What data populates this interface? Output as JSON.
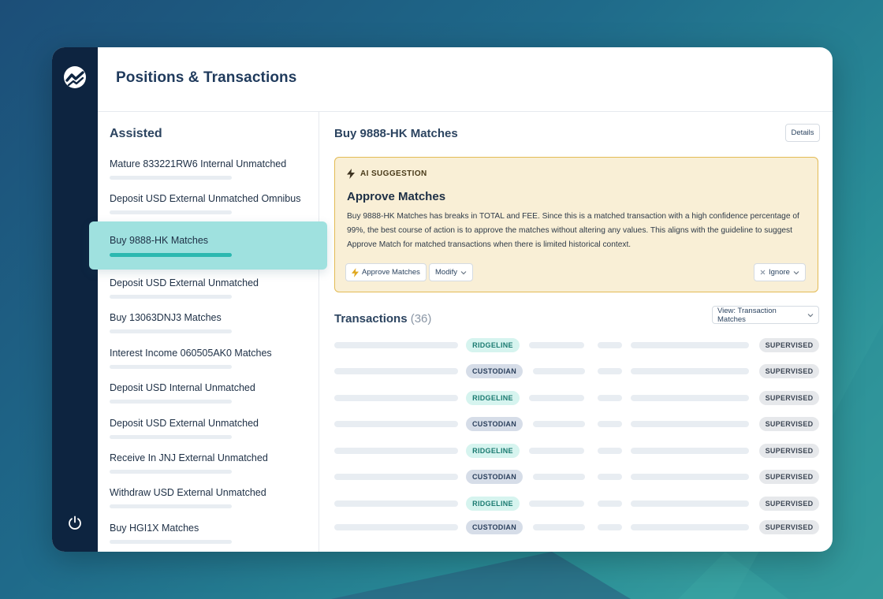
{
  "app": {
    "page_title": "Positions & Transactions"
  },
  "sidebar": {
    "title": "Assisted",
    "items": [
      {
        "label": "Mature 833221RW6 Internal Unmatched"
      },
      {
        "label": "Deposit USD External Unmatched Omnibus"
      },
      {
        "label": "Buy 9888-HK Matches",
        "active": true
      },
      {
        "label": "Deposit USD External Unmatched"
      },
      {
        "label": "Buy 13063DNJ3 Matches"
      },
      {
        "label": "Interest Income 060505AK0 Matches"
      },
      {
        "label": "Deposit USD Internal Unmatched"
      },
      {
        "label": "Deposit USD External Unmatched"
      },
      {
        "label": "Receive In JNJ External Unmatched"
      },
      {
        "label": "Withdraw USD External Unmatched"
      },
      {
        "label": "Buy HGI1X Matches"
      }
    ]
  },
  "main": {
    "title": "Buy 9888-HK Matches",
    "details_label": "Details",
    "ai": {
      "tag": "AI SUGGESTION",
      "heading": "Approve Matches",
      "body": "Buy 9888-HK Matches has breaks in TOTAL and FEE. Since this is a matched transaction with a high confidence percentage of 99%, the best course of action is to approve the matches without altering any values. This aligns with the guideline to suggest Approve Match for matched transactions when there is limited historical context.",
      "approve_label": "Approve Matches",
      "modify_label": "Modify",
      "ignore_label": "Ignore"
    },
    "transactions": {
      "title": "Transactions",
      "count": "(36)",
      "view_label": "View: Transaction Matches",
      "rows": [
        {
          "source": "RIDGELINE",
          "status": "SUPERVISED"
        },
        {
          "source": "CUSTODIAN",
          "status": "SUPERVISED"
        },
        {
          "source": "RIDGELINE",
          "status": "SUPERVISED"
        },
        {
          "source": "CUSTODIAN",
          "status": "SUPERVISED"
        },
        {
          "source": "RIDGELINE",
          "status": "SUPERVISED"
        },
        {
          "source": "CUSTODIAN",
          "status": "SUPERVISED"
        },
        {
          "source": "RIDGELINE",
          "status": "SUPERVISED"
        },
        {
          "source": "CUSTODIAN",
          "status": "SUPERVISED"
        }
      ]
    }
  },
  "icons": {
    "rail_logo": "chart-logo-icon",
    "rail_bottom": "power-icon",
    "ai_tag": "lightning-icon",
    "approve": "lightning-icon",
    "dropdown": "chevron-down-icon",
    "ignore": "close-icon"
  },
  "colors": {
    "rail": "#0d2440",
    "active_item": "#9fe1df",
    "ai_card_bg": "#f9efd6",
    "ai_card_border": "#e3bb55",
    "ridgeline_pill": "#d6f4ef",
    "custodian_pill": "#d6dde8"
  }
}
